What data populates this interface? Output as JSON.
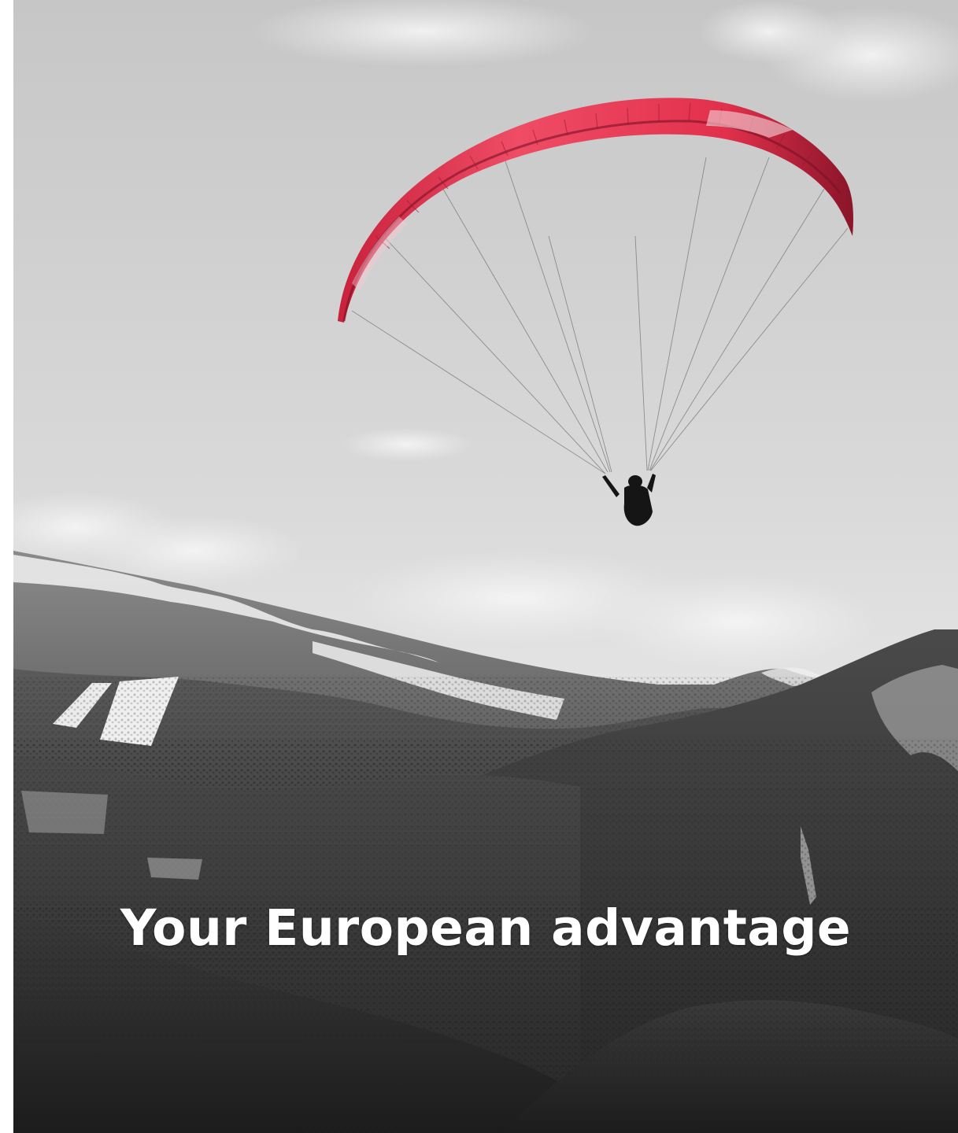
{
  "hero": {
    "headline": "Your European advantage"
  },
  "colors": {
    "canopy": "#e8364f",
    "canopy_dark": "#a81c33",
    "headline_text": "#ffffff",
    "sky_top": "#c9c9c9",
    "sky_bottom": "#e4e4e4",
    "mountain_dark": "#2f2f2f"
  }
}
